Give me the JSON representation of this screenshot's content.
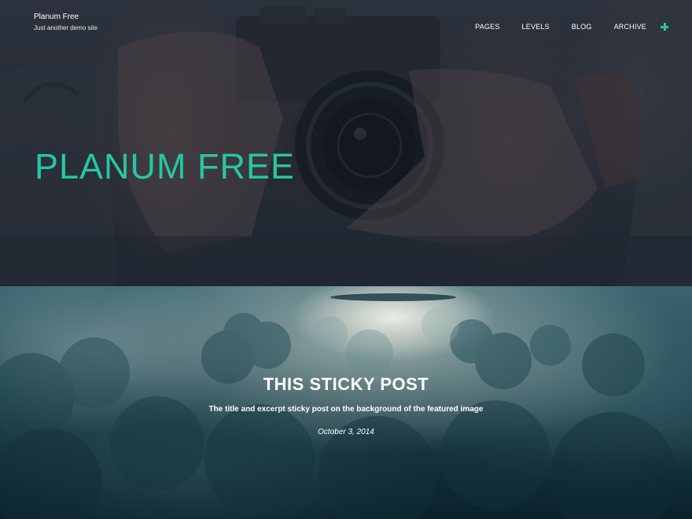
{
  "site": {
    "title": "Planum Free",
    "description": "Just another demo site"
  },
  "nav": {
    "items": [
      "PAGES",
      "LEVELS",
      "BLOG",
      "ARCHIVE"
    ],
    "more_icon": "plus-icon",
    "accent": "#2bc5a1"
  },
  "hero": {
    "title": "PLANUM FREE",
    "title_color": "#26c7a2"
  },
  "sticky_post": {
    "title": "THIS STICKY POST",
    "excerpt": "The title and excerpt sticky post on the background of the featured image",
    "date": "October 3, 2014"
  }
}
